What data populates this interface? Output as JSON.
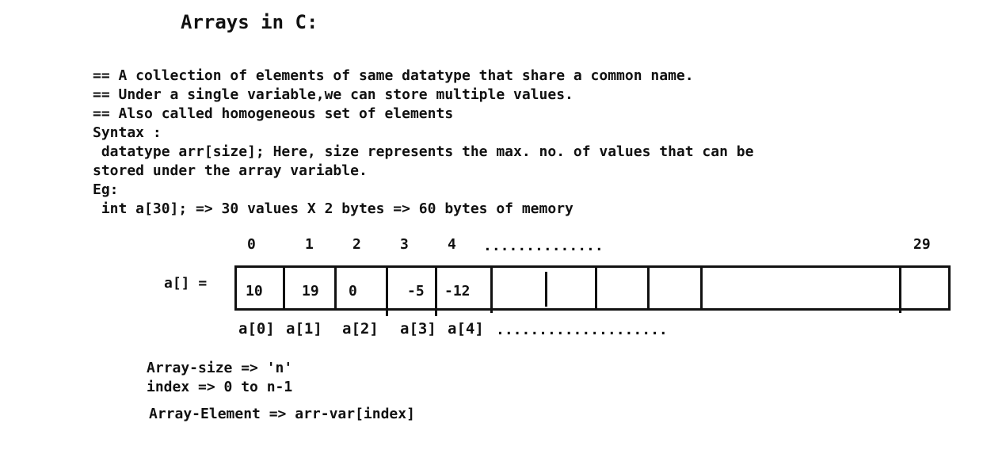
{
  "title": "Arrays in C:",
  "lines": [
    "== A collection of elements of same datatype that share a common name.",
    "== Under a single variable,we can store multiple values.",
    "== Also called homogeneous set of elements",
    "Syntax :",
    " datatype arr[size]; Here, size represents the max. no. of values that can be",
    "stored under the array variable.",
    "Eg:",
    " int a[30]; => 30 values X 2 bytes => 60 bytes of memory"
  ],
  "diagram": {
    "indices": [
      "0",
      "1",
      "2",
      "3",
      "4",
      "29"
    ],
    "index_dots": "..............",
    "array_label": "a[] =",
    "values": [
      "10",
      "19",
      "0",
      "-5",
      "-12"
    ],
    "element_labels": [
      "a[0]",
      "a[1]",
      "a[2]",
      "a[3]",
      "a[4]"
    ],
    "label_dots": "...................."
  },
  "notes": [
    "Array-size => 'n'",
    "index => 0 to n-1",
    "Array-Element => arr-var[index]"
  ]
}
